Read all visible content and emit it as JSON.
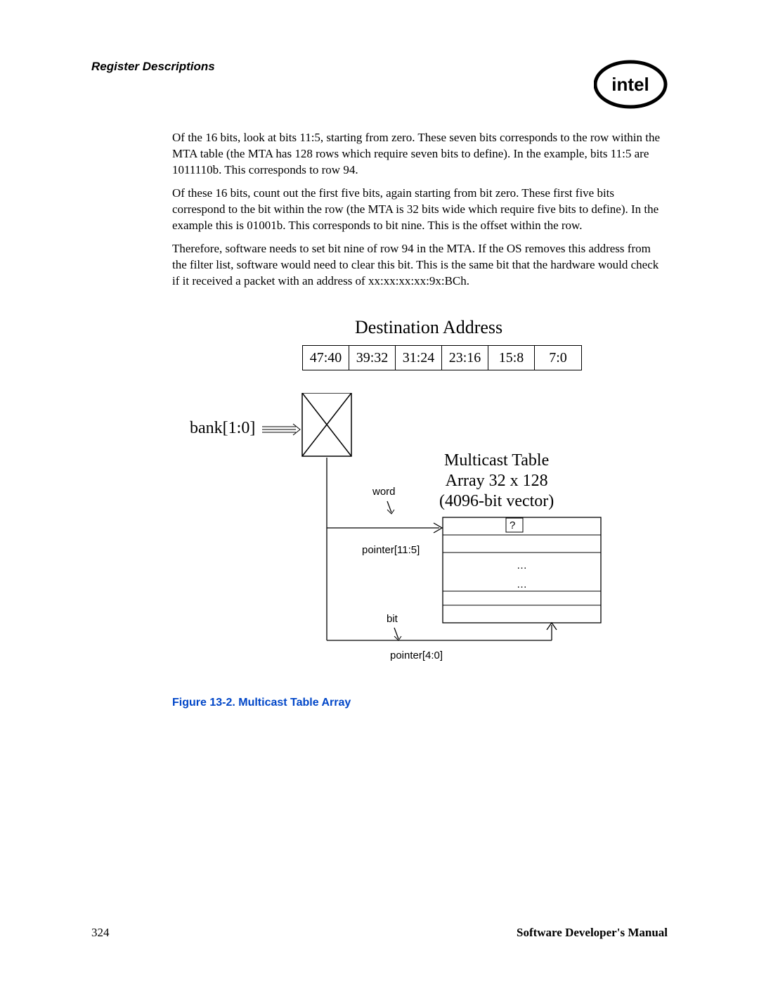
{
  "header": {
    "section_title": "Register Descriptions",
    "logo_name": "intel"
  },
  "paragraphs": {
    "p1": "Of the 16 bits, look at bits 11:5, starting from zero. These seven bits corresponds to the row within the MTA table (the MTA has 128 rows which require seven bits to define). In the example, bits 11:5 are 1011110b. This corresponds to row 94.",
    "p2": "Of these 16 bits, count out the first five bits, again starting from bit zero. These first five bits correspond to the bit within the row (the MTA is 32 bits wide which require five bits to define). In the example this is 01001b. This corresponds to bit nine. This is the offset within the row.",
    "p3": "Therefore, software needs to set bit nine of row 94 in the MTA. If the OS removes this address from the filter list, software would need to clear this bit. This is the same bit that the hardware would check if it received a packet with an address of xx:xx:xx:xx:9x:BCh."
  },
  "diagram": {
    "title": "Destination Address",
    "bit_ranges": [
      "47:40",
      "39:32",
      "31:24",
      "23:16",
      "15:8",
      "7:0"
    ],
    "bank_label": "bank[1:0]",
    "mtab_line1": "Multicast Table",
    "mtab_line2": "Array 32 x 128",
    "mtab_line3": "(4096-bit vector)",
    "word_label": "word",
    "pointer115": "pointer[11:5]",
    "bit_label": "bit",
    "pointer40": "pointer[4:0]",
    "question_mark": "?",
    "dots": "…"
  },
  "figure_caption": "Figure 13-2. Multicast Table Array",
  "footer": {
    "page_number": "324",
    "doc_title": "Software Developer's Manual"
  }
}
